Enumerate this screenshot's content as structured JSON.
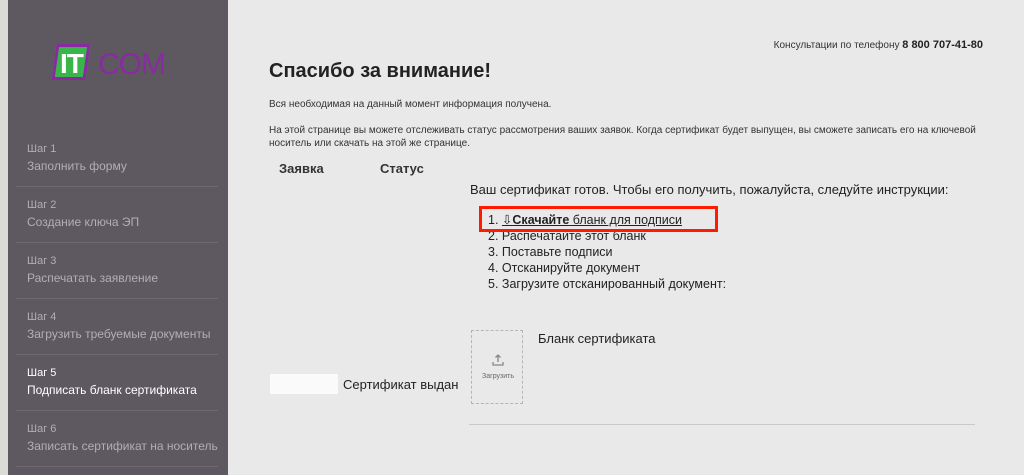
{
  "logo": {
    "part1": "IT",
    "part2": "COM"
  },
  "sidebar": {
    "steps": [
      {
        "num": "Шаг 1",
        "label": "Заполнить форму"
      },
      {
        "num": "Шаг 2",
        "label": "Создание ключа ЭП"
      },
      {
        "num": "Шаг 3",
        "label": "Распечатать заявление"
      },
      {
        "num": "Шаг 4",
        "label": "Загрузить требуемые документы"
      },
      {
        "num": "Шаг 5",
        "label": "Подписать бланк сертификата"
      },
      {
        "num": "Шаг 6",
        "label": "Записать сертификат на носитель"
      }
    ],
    "active_step": 5
  },
  "header": {
    "phone_label": "Консультации по телефону",
    "phone_number": "8 800 707-41-80"
  },
  "main": {
    "title": "Спасибо за внимание!",
    "info_received": "Вся необходимая на данный момент информация получена.",
    "info_status": "На этой странице вы можете отслеживать статус рассмотрения ваших заявок. Когда сертификат будет выпущен, вы сможете записать его на ключевой носитель или скачать на этой же странице.",
    "columns": {
      "request": "Заявка",
      "status": "Статус"
    },
    "cert_ready": "Ваш сертификат готов. Чтобы его получить, пожалуйста, следуйте инструкции:",
    "steps": {
      "s1_num": "1.",
      "s1_icon": "⇩",
      "s1_bold": "Скачайте",
      "s1_rest": " бланк для подписи",
      "s2": "2. Распечатайте этот бланк",
      "s3": "3. Поставьте подписи",
      "s4": "4. Отсканируйте документ",
      "s5": "5. Загрузите отсканированный документ:"
    },
    "upload_label": "Загрузить",
    "blank_label": "Бланк сертификата",
    "cert_issued": "Сертификат выдан",
    "highlight_color": "#ff1a00"
  }
}
